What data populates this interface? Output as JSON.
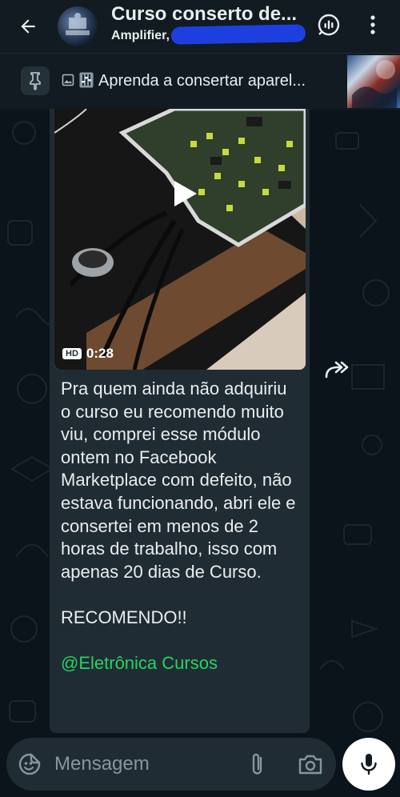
{
  "header": {
    "title": "Curso conserto de...",
    "subtitle": "Amplifier, +",
    "subtitle_hidden": "··· ·· ·· ··· ·42",
    "back_icon": "arrow-left-icon",
    "channel_icon": "channel-icon",
    "menu_icon": "kebab-menu-icon"
  },
  "pinned": {
    "text": "Aprenda a consertar aparel..."
  },
  "message": {
    "video_duration": "0:28",
    "hd_badge": "HD",
    "lines": [
      "Pra quem ainda não adquiriu o curso eu recomendo muito viu, comprei esse módulo ontem no Facebook Marketplace com defeito, não estava funcionando, abri ele e consertei em menos de 2 horas de trabalho, isso com apenas 20 dias de Curso.",
      "RECOMENDO!!",
      "@Eletrônica Cursos"
    ]
  },
  "composer": {
    "placeholder": "Mensagem"
  },
  "colors": {
    "background": "#0b141a",
    "header": "#111b21",
    "bubble": "#202c33",
    "mention": "#25d366",
    "text": "#e9edef",
    "muted": "#8696a0"
  }
}
